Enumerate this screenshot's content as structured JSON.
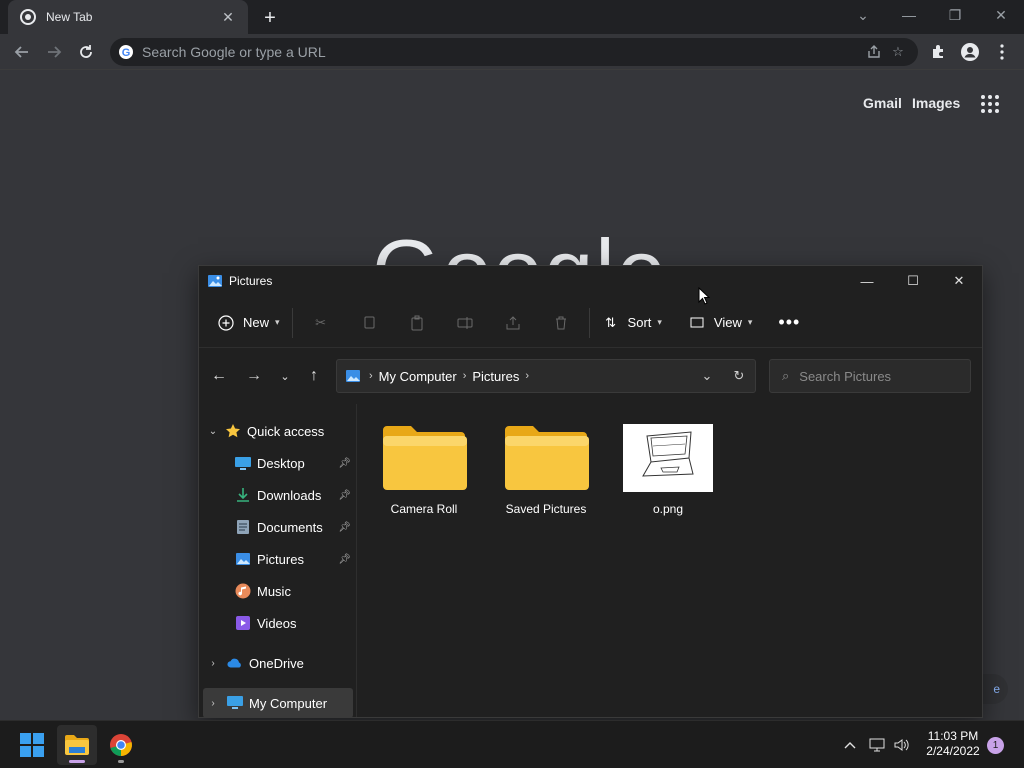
{
  "chrome": {
    "tab_title": "New Tab",
    "omnibox_placeholder": "Search Google or type a URL",
    "gmail_link": "Gmail",
    "images_link": "Images",
    "logo_text": "Google",
    "customize_label": "e"
  },
  "explorer": {
    "window_title": "Pictures",
    "cmd": {
      "new_label": "New",
      "sort_label": "Sort",
      "view_label": "View"
    },
    "breadcrumb": [
      "My Computer",
      "Pictures"
    ],
    "search_placeholder": "Search Pictures",
    "sidebar": {
      "quick_access": "Quick access",
      "items": [
        {
          "label": "Desktop",
          "icon": "desktop-icon",
          "pinned": true
        },
        {
          "label": "Downloads",
          "icon": "downloads-icon",
          "pinned": true
        },
        {
          "label": "Documents",
          "icon": "documents-icon",
          "pinned": true
        },
        {
          "label": "Pictures",
          "icon": "pictures-icon",
          "pinned": true
        },
        {
          "label": "Music",
          "icon": "music-icon",
          "pinned": false
        },
        {
          "label": "Videos",
          "icon": "videos-icon",
          "pinned": false
        }
      ],
      "onedrive": "OneDrive",
      "my_computer": "My Computer"
    },
    "files": [
      {
        "name": "Camera Roll",
        "type": "folder"
      },
      {
        "name": "Saved Pictures",
        "type": "folder"
      },
      {
        "name": "o.png",
        "type": "image"
      }
    ]
  },
  "taskbar": {
    "time": "11:03 PM",
    "date": "2/24/2022",
    "notification_count": "1"
  },
  "colors": {
    "folder_yellow": "#f8c63f",
    "chrome_bg": "#35363a",
    "explorer_bg": "#202020",
    "accent": "#8ab4f8"
  }
}
